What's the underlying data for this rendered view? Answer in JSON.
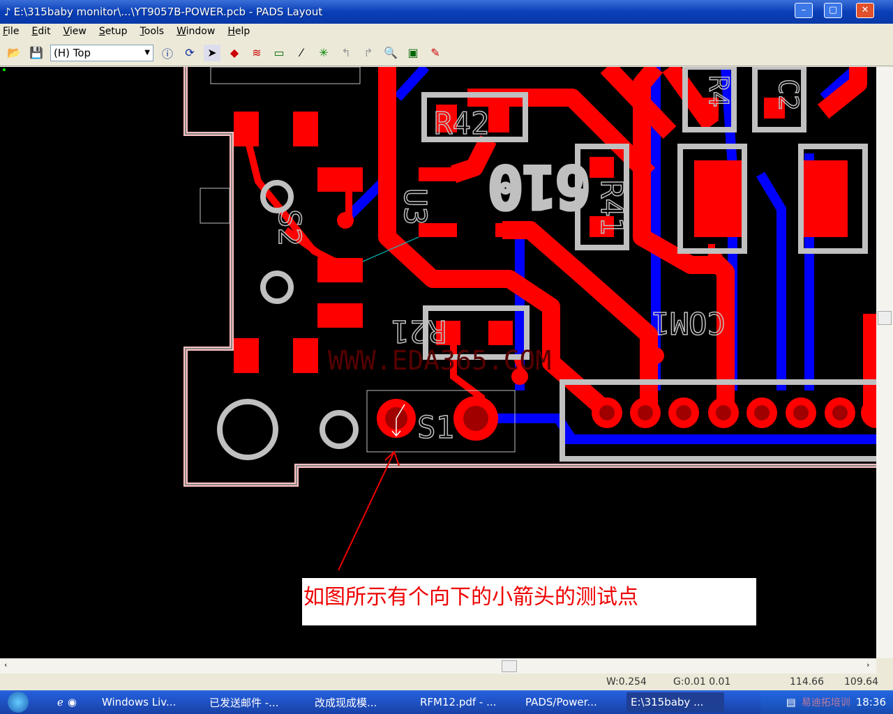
{
  "window": {
    "title": "E:\\315baby monitor\\...\\YT9057B-POWER.pcb - PADS Layout",
    "minimize": "–",
    "maximize": "▢",
    "close": "✕"
  },
  "menu": [
    "File",
    "Edit",
    "View",
    "Setup",
    "Tools",
    "Window",
    "Help"
  ],
  "toolbar": {
    "layer": "(H) Top",
    "icons": [
      "open-icon",
      "save-icon",
      "info-icon",
      "refresh-icon",
      "select-arrow-icon",
      "component-icon",
      "route-icon",
      "dimension-icon",
      "line-icon",
      "cluster-icon",
      "undo-icon",
      "redo-icon",
      "zoom-icon",
      "board-icon",
      "eco-icon"
    ]
  },
  "pcb": {
    "labels": {
      "r42": "R42",
      "u3": "U3",
      "s2": "S2",
      "r41": "R41",
      "r21": "R21",
      "s1": "S1",
      "com1": "COM1",
      "r4": "R4",
      "c2": "C2",
      "big": "610"
    },
    "watermark": "WWW.EDA365.COM",
    "annotation": "如图所示有个向下的小箭头的测试点",
    "colors": {
      "top_copper": "#ff0000",
      "bottom_copper": "#0000ff",
      "silkscreen": "#c0c0c0",
      "board_outline": "#ffc0c0"
    }
  },
  "status": {
    "width": "W:0.254",
    "grid": "G:0.01 0.01",
    "x": "114.66",
    "y": "109.64"
  },
  "taskbar": {
    "items": [
      "Windows Liv...",
      "已发送邮件 -...",
      "改成现成模...",
      "RFM12.pdf - ...",
      "PADS/Power...",
      "E:\\315baby ..."
    ],
    "clock": "18:36",
    "watermark": "易迪拓培训"
  }
}
